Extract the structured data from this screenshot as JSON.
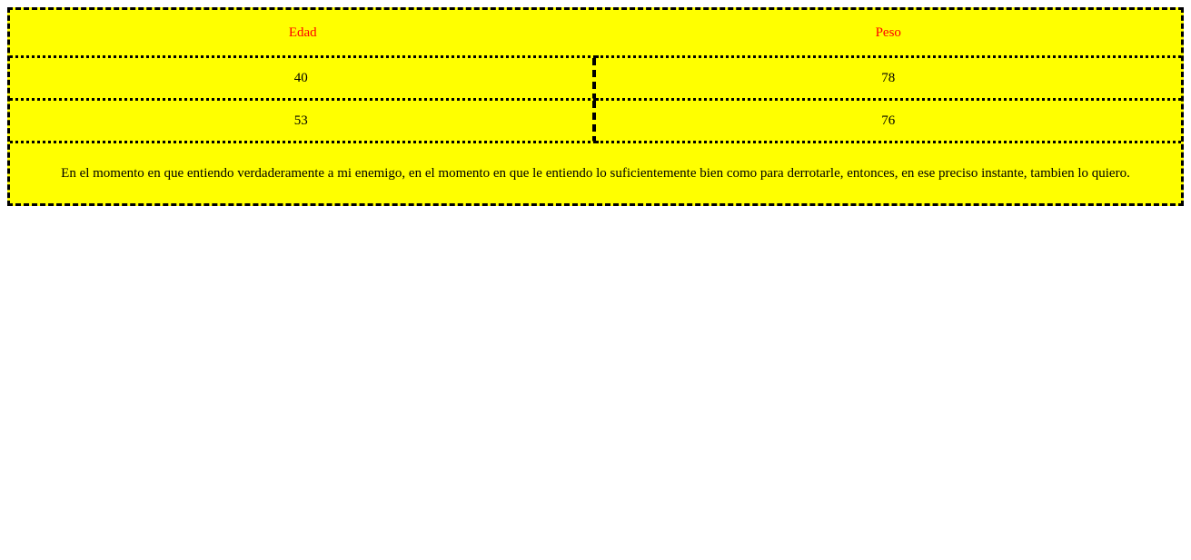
{
  "table": {
    "headers": [
      "Edad",
      "Peso"
    ],
    "rows": [
      [
        "40",
        "78"
      ],
      [
        "53",
        "76"
      ]
    ],
    "footer_text": "En el momento en que entiendo verdaderamente a mi enemigo, en el momento en que le entiendo lo suficientemente bien como para derrotarle, entonces, en ese preciso instante, tambien lo quiero."
  },
  "colors": {
    "table_background": "#ffff00",
    "header_text": "#ff0000",
    "border": "#000000",
    "page_background": "#ffffff"
  }
}
